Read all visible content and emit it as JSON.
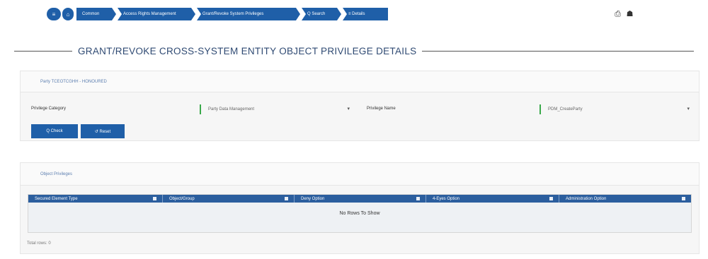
{
  "breadcrumbs": {
    "home_glyphs": "≡ ⟳",
    "items": [
      "Common",
      "Access Rights Management",
      "Grant/Revoke System Privileges",
      "Q Search",
      "≡ Details"
    ]
  },
  "topbar": {
    "icons": [
      "print-icon",
      "users-icon"
    ]
  },
  "page": {
    "title": "GRANT/REVOKE CROSS-SYSTEM ENTITY OBJECT PRIVILEGE DETAILS"
  },
  "party_panel": {
    "header": "Party TCEOTCGHH - HONOURED",
    "privilege_category_label": "Privilege Category",
    "privilege_category_value": "Party Data Management",
    "privilege_name_label": "Privilege Name",
    "privilege_name_value": "PDM_CreateParty",
    "check_button": "Q Check",
    "reset_button": "↺ Reset"
  },
  "object_panel": {
    "header": "Object Privileges",
    "columns": [
      "Secured Element Type",
      "Object/Group",
      "Deny Option",
      "4-Eyes Option",
      "Administration Option"
    ],
    "empty_text": "No Rows To Show",
    "total_rows": "Total rows: 0"
  },
  "colors": {
    "primary": "#1f5fa8",
    "table_header": "#2b5e9e",
    "accent_green": "#3aa94a",
    "title": "#2f4a73"
  }
}
